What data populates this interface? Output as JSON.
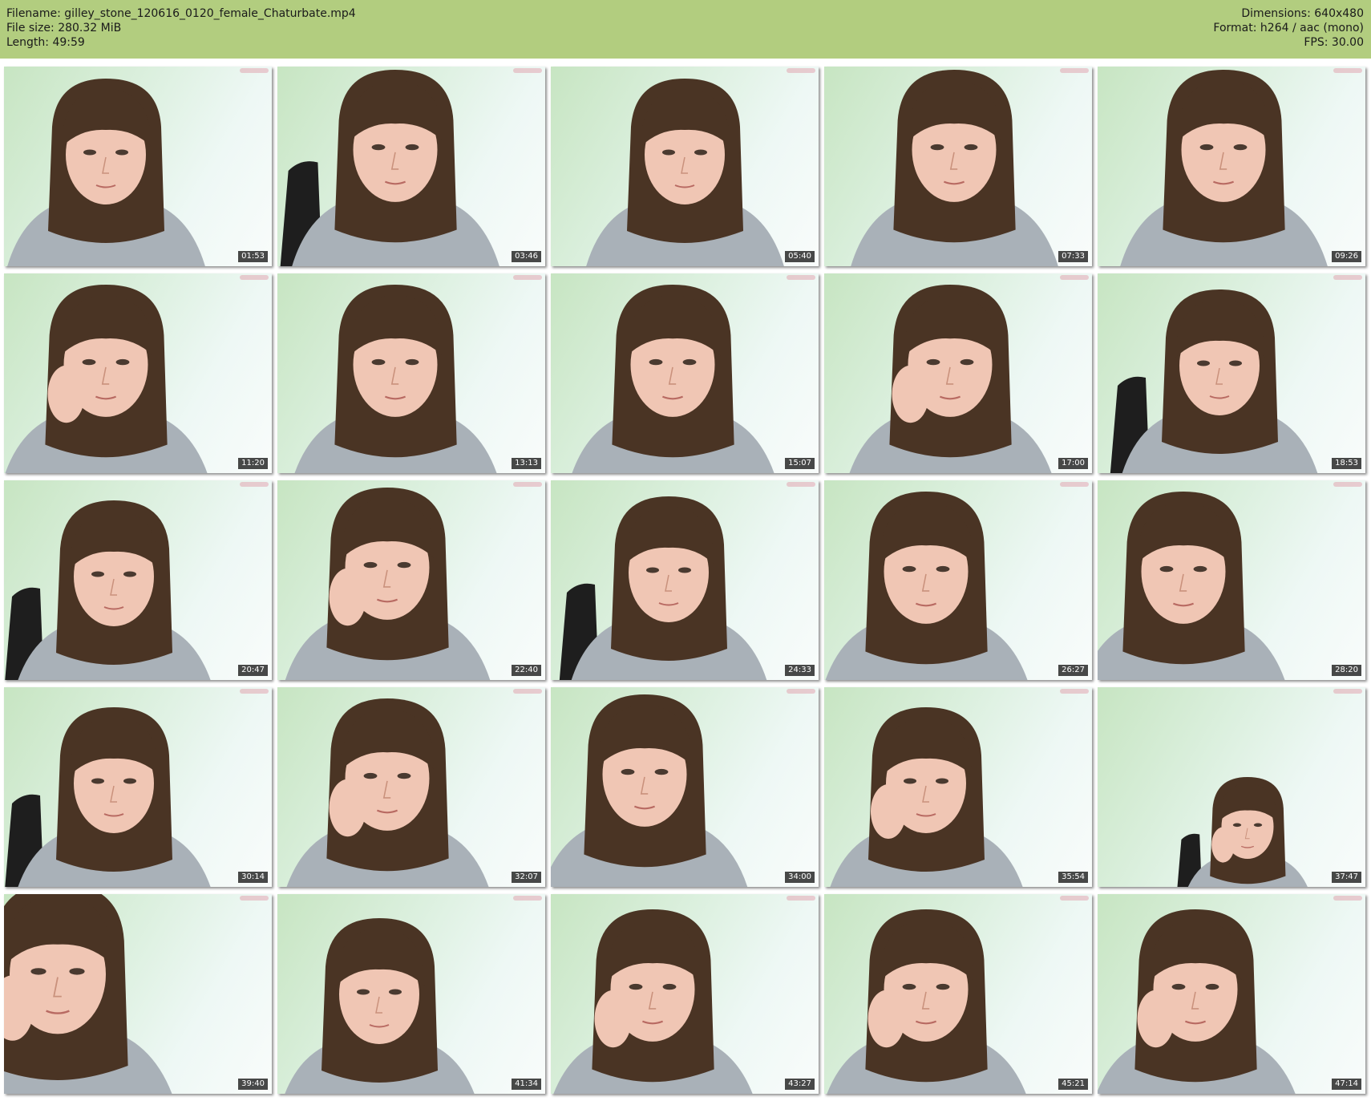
{
  "header": {
    "filename_line": "Filename: gilley_stone_120616_0120_female_Chaturbate.mp4",
    "filesize_line": "File size: 280.32 MiB",
    "length_line": "Length: 49:59",
    "dimensions_line": "Dimensions: 640x480",
    "format_line": "Format: h264 / aac (mono)",
    "fps_line": "FPS: 30.00"
  },
  "colors": {
    "header_bg": "#b2cd7f",
    "thumb_bg_start": "#c7e5c2",
    "thumb_bg_end": "#f9fcfb",
    "hair": "#4a3424",
    "skin": "#f0c6b4",
    "sweater": "#a9b1b8",
    "chair": "#1e1e1e"
  },
  "thumbnails": [
    {
      "time": "01:53"
    },
    {
      "time": "03:46"
    },
    {
      "time": "05:40"
    },
    {
      "time": "07:33"
    },
    {
      "time": "09:26"
    },
    {
      "time": "11:20"
    },
    {
      "time": "13:13"
    },
    {
      "time": "15:07"
    },
    {
      "time": "17:00"
    },
    {
      "time": "18:53"
    },
    {
      "time": "20:47"
    },
    {
      "time": "22:40"
    },
    {
      "time": "24:33"
    },
    {
      "time": "26:27"
    },
    {
      "time": "28:20"
    },
    {
      "time": "30:14"
    },
    {
      "time": "32:07"
    },
    {
      "time": "34:00"
    },
    {
      "time": "35:54"
    },
    {
      "time": "37:47"
    },
    {
      "time": "39:40"
    },
    {
      "time": "41:34"
    },
    {
      "time": "43:27"
    },
    {
      "time": "45:21"
    },
    {
      "time": "47:14"
    }
  ]
}
